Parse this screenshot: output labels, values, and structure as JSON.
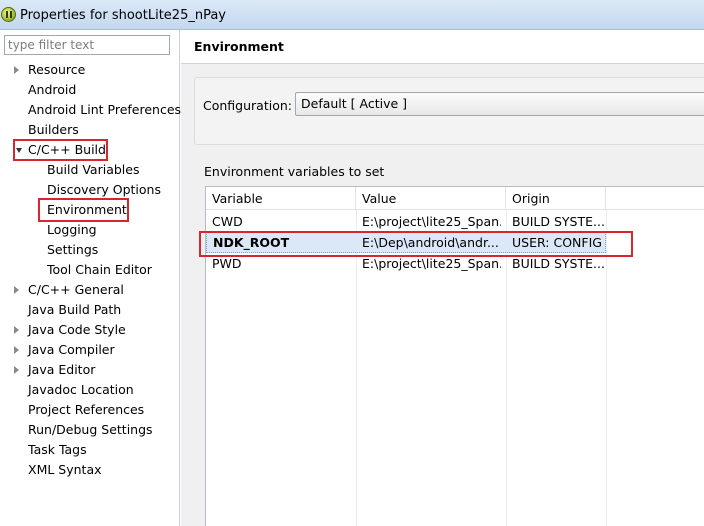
{
  "window": {
    "title": "Properties for shootLite25_nPay"
  },
  "filter": {
    "placeholder": "type filter text"
  },
  "tree": {
    "items": [
      {
        "label": "Resource",
        "expander": "closed"
      },
      {
        "label": "Android",
        "expander": "none"
      },
      {
        "label": "Android Lint Preferences",
        "expander": "none"
      },
      {
        "label": "Builders",
        "expander": "none"
      },
      {
        "label": "C/C++ Build",
        "expander": "open"
      },
      {
        "label": "Build Variables",
        "expander": "none"
      },
      {
        "label": "Discovery Options",
        "expander": "none"
      },
      {
        "label": "Environment",
        "expander": "none"
      },
      {
        "label": "Logging",
        "expander": "none"
      },
      {
        "label": "Settings",
        "expander": "none"
      },
      {
        "label": "Tool Chain Editor",
        "expander": "none"
      },
      {
        "label": "C/C++ General",
        "expander": "closed"
      },
      {
        "label": "Java Build Path",
        "expander": "none"
      },
      {
        "label": "Java Code Style",
        "expander": "closed"
      },
      {
        "label": "Java Compiler",
        "expander": "closed"
      },
      {
        "label": "Java Editor",
        "expander": "closed"
      },
      {
        "label": "Javadoc Location",
        "expander": "none"
      },
      {
        "label": "Project References",
        "expander": "none"
      },
      {
        "label": "Run/Debug Settings",
        "expander": "none"
      },
      {
        "label": "Task Tags",
        "expander": "none"
      },
      {
        "label": "XML Syntax",
        "expander": "none"
      }
    ]
  },
  "page": {
    "title": "Environment",
    "configuration_label": "Configuration:",
    "configuration_value": "Default  [ Active ]",
    "env_section_label": "Environment variables to set"
  },
  "table": {
    "columns": [
      "Variable",
      "Value",
      "Origin"
    ],
    "rows": [
      {
        "variable": "CWD",
        "value": "E:\\project\\lite25_Span...",
        "origin": "BUILD SYSTE..."
      },
      {
        "variable": "NDK_ROOT",
        "value": "E:\\Dep\\android\\andr...",
        "origin": "USER: CONFIG"
      },
      {
        "variable": "PWD",
        "value": "E:\\project\\lite25_Span...",
        "origin": "BUILD SYSTE..."
      }
    ]
  },
  "colors": {
    "highlight_box": "#d7262e",
    "selection": "#dbe8f8"
  }
}
